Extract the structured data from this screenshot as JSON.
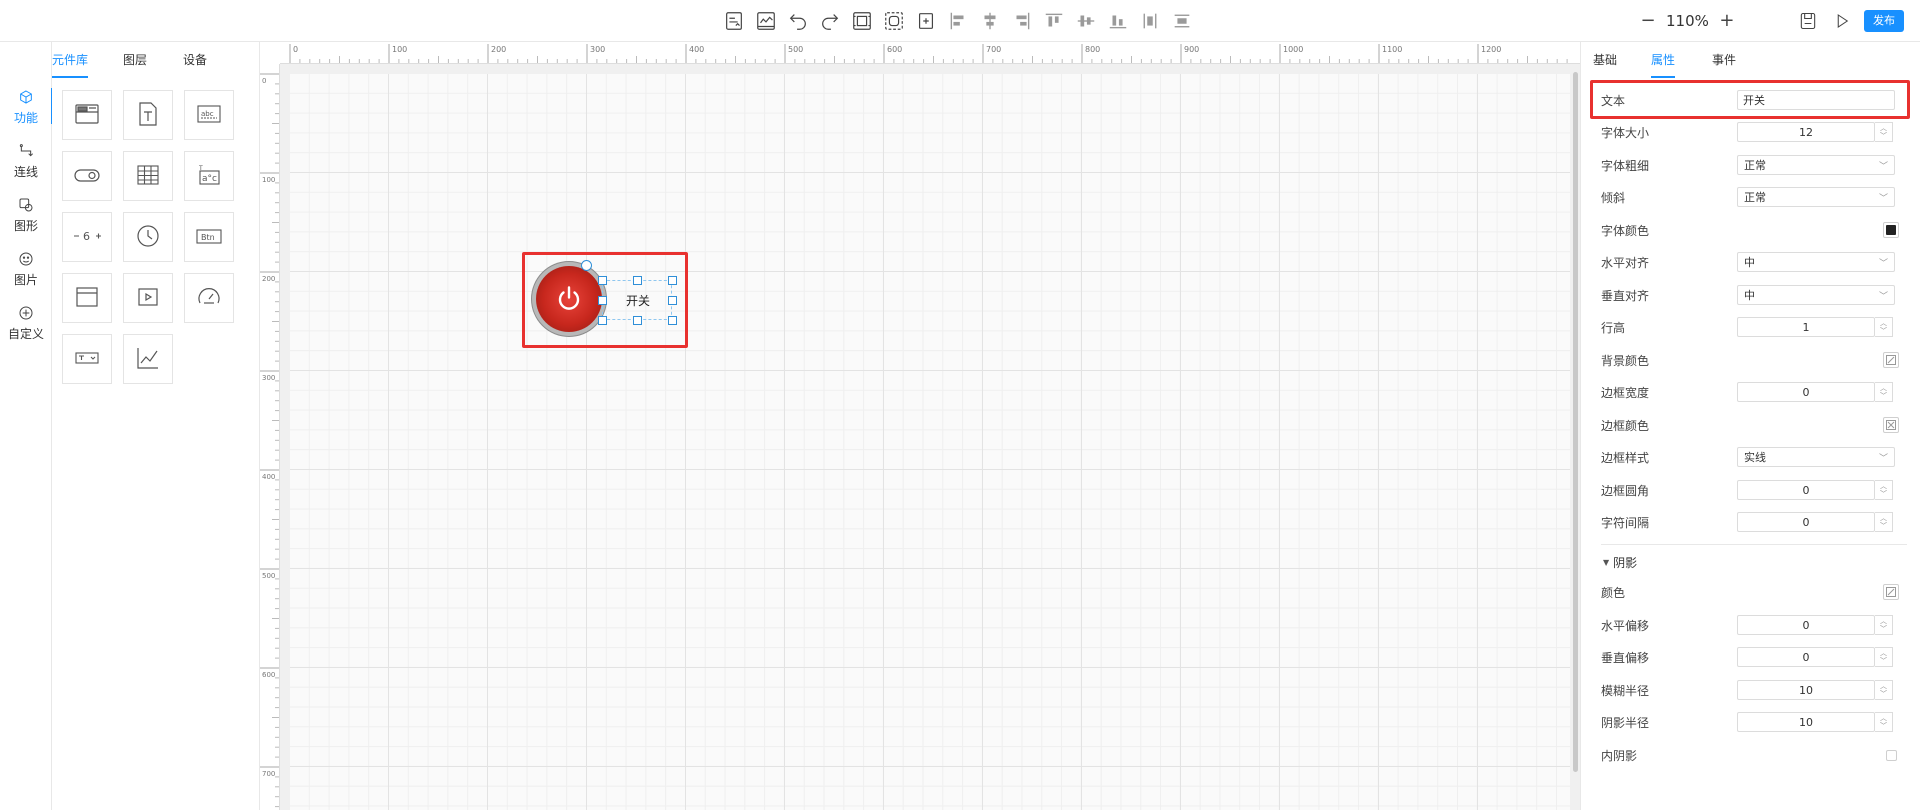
{
  "toolbar": {
    "icons": [
      "template-icon",
      "chart-icon",
      "undo-icon",
      "redo-icon",
      "group-icon",
      "ungroup-icon",
      "distribute-icon",
      "align-left-icon",
      "align-center-icon",
      "align-right-icon",
      "align-top-icon",
      "align-middle-icon",
      "align-bottom-icon",
      "distribute-h-icon",
      "distribute-v-icon"
    ],
    "zoom_out": "−",
    "zoom_value": "110%",
    "zoom_in": "+",
    "publish_label": "发布"
  },
  "left_rail": {
    "items": [
      {
        "label": "功能",
        "icon": "cube-icon",
        "active": true
      },
      {
        "label": "连线",
        "icon": "connector-icon",
        "active": false
      },
      {
        "label": "图形",
        "icon": "shape-icon",
        "active": false
      },
      {
        "label": "图片",
        "icon": "image-icon",
        "active": false
      },
      {
        "label": "自定义",
        "icon": "plus-circle-icon",
        "active": false
      }
    ]
  },
  "library": {
    "tabs": [
      {
        "label": "元件库",
        "active": true
      },
      {
        "label": "图层",
        "active": false
      },
      {
        "label": "设备",
        "active": false
      }
    ],
    "components": [
      "window-icon",
      "text-icon",
      "textbox-icon",
      "switch-icon",
      "table-icon",
      "formula-icon",
      "stepper-icon",
      "clock-icon",
      "button-icon",
      "panel-icon",
      "video-icon",
      "gauge-icon",
      "select-icon",
      "line-chart-icon"
    ],
    "textbox_label": "abc",
    "stepper_label": "6",
    "button_label": "Btn"
  },
  "ruler": {
    "x_ticks": [
      "0",
      "100",
      "200",
      "300",
      "400",
      "500",
      "600",
      "700",
      "800",
      "900",
      "1000",
      "1100",
      "1200"
    ],
    "y_ticks": [
      "0",
      "100",
      "200",
      "300",
      "400",
      "500",
      "600",
      "700"
    ]
  },
  "canvas": {
    "switch_text": "开关"
  },
  "props": {
    "tabs": [
      {
        "label": "基础",
        "active": false
      },
      {
        "label": "属性",
        "active": true
      },
      {
        "label": "事件",
        "active": false
      }
    ],
    "text": {
      "label": "文本",
      "value": "开关"
    },
    "font_size": {
      "label": "字体大小",
      "value": "12"
    },
    "font_weight": {
      "label": "字体粗细",
      "value": "正常"
    },
    "italic": {
      "label": "倾斜",
      "value": "正常"
    },
    "font_color": {
      "label": "字体颜色",
      "color": "#222222"
    },
    "h_align": {
      "label": "水平对齐",
      "value": "中"
    },
    "v_align": {
      "label": "垂直对齐",
      "value": "中"
    },
    "line_height": {
      "label": "行高",
      "value": "1"
    },
    "bg_color": {
      "label": "背景颜色"
    },
    "border_width": {
      "label": "边框宽度",
      "value": "0"
    },
    "border_color": {
      "label": "边框颜色"
    },
    "border_style": {
      "label": "边框样式",
      "value": "实线"
    },
    "border_radius": {
      "label": "边框圆角",
      "value": "0"
    },
    "letter_spacing": {
      "label": "字符间隔",
      "value": "0"
    },
    "shadow_section": "阴影",
    "shadow_color": {
      "label": "颜色"
    },
    "shadow_h_offset": {
      "label": "水平偏移",
      "value": "0"
    },
    "shadow_v_offset": {
      "label": "垂直偏移",
      "value": "0"
    },
    "shadow_blur": {
      "label": "模糊半径",
      "value": "10"
    },
    "shadow_spread": {
      "label": "阴影半径",
      "value": "10"
    },
    "inner_shadow": {
      "label": "内阴影"
    }
  },
  "colors": {
    "accent": "#1890ff",
    "highlight": "#e8312f",
    "switch_red": "#c7271d"
  }
}
